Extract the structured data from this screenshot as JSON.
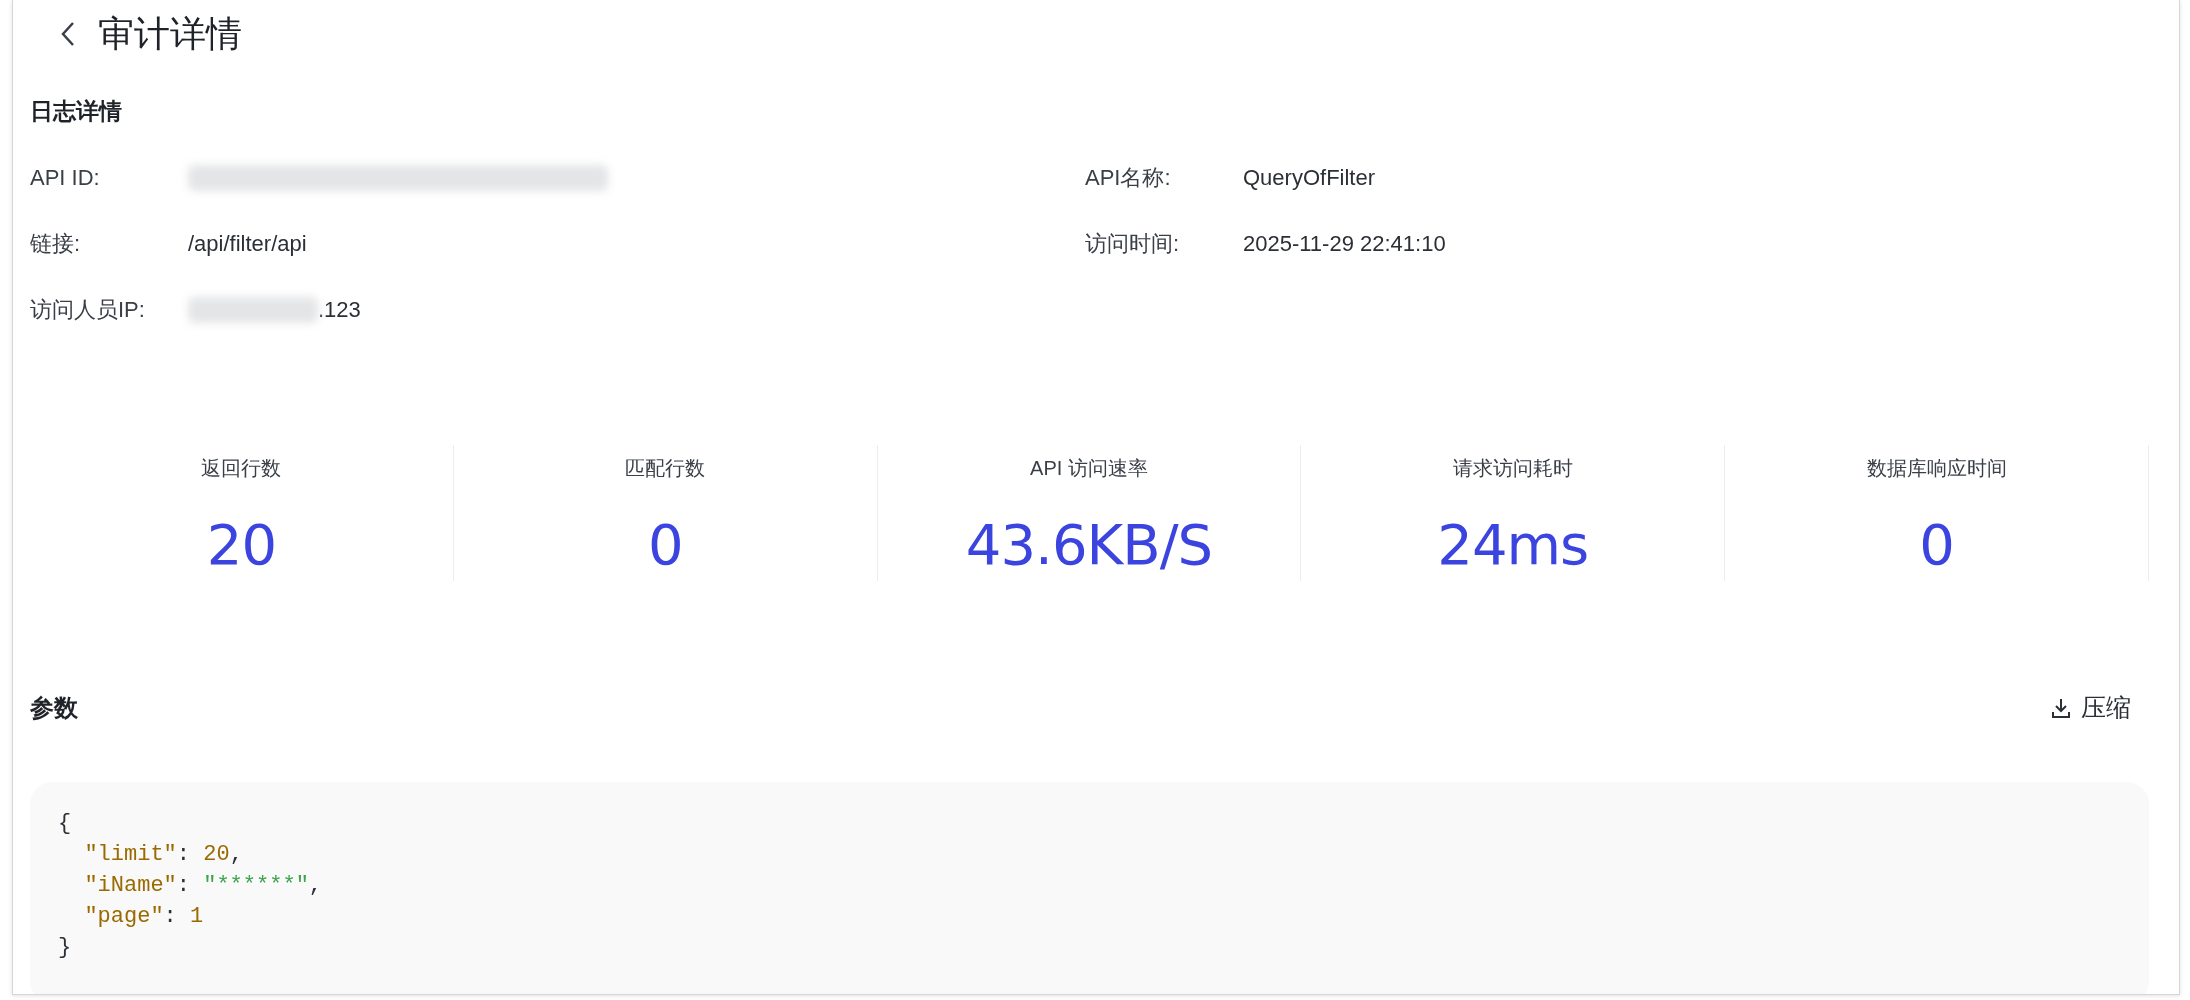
{
  "header": {
    "title": "审计详情"
  },
  "log_details": {
    "title": "日志详情",
    "fields": [
      {
        "label": "API ID:",
        "blurred": true
      },
      {
        "label": "API名称:",
        "value": "QueryOfFilter",
        "blurred": false
      },
      {
        "label": "链接:",
        "value": "/api/filter/api",
        "blurred": false
      },
      {
        "label": "访问时间:",
        "value": "2025-11-29 22:41:10",
        "blurred": false
      },
      {
        "label": "访问人员IP:",
        "value": ".123",
        "blurred": true
      }
    ]
  },
  "stats": [
    {
      "label": "返回行数",
      "value": "20"
    },
    {
      "label": "匹配行数",
      "value": "0"
    },
    {
      "label": "API 访问速率",
      "value": "43.6KB/S"
    },
    {
      "label": "请求访问耗时",
      "value": "24ms"
    },
    {
      "label": "数据库响应时间",
      "value": "0"
    }
  ],
  "params": {
    "title": "参数",
    "compress_button": "压缩",
    "code_lines": [
      {
        "indented": false,
        "tokens": [
          {
            "kind": "punct",
            "text": "{"
          }
        ]
      },
      {
        "indented": true,
        "tokens": [
          {
            "kind": "key",
            "text": "\"limit\""
          },
          {
            "kind": "punct",
            "text": ": "
          },
          {
            "kind": "number",
            "text": "20"
          },
          {
            "kind": "punct",
            "text": ","
          }
        ]
      },
      {
        "indented": true,
        "tokens": [
          {
            "kind": "key",
            "text": "\"iName\""
          },
          {
            "kind": "punct",
            "text": ": "
          },
          {
            "kind": "string",
            "text": "\"******\""
          },
          {
            "kind": "punct",
            "text": ","
          }
        ]
      },
      {
        "indented": true,
        "tokens": [
          {
            "kind": "key",
            "text": "\"page\""
          },
          {
            "kind": "punct",
            "text": ": "
          },
          {
            "kind": "number",
            "text": "1"
          }
        ]
      },
      {
        "indented": false,
        "tokens": [
          {
            "kind": "punct",
            "text": "}"
          }
        ]
      }
    ]
  }
}
